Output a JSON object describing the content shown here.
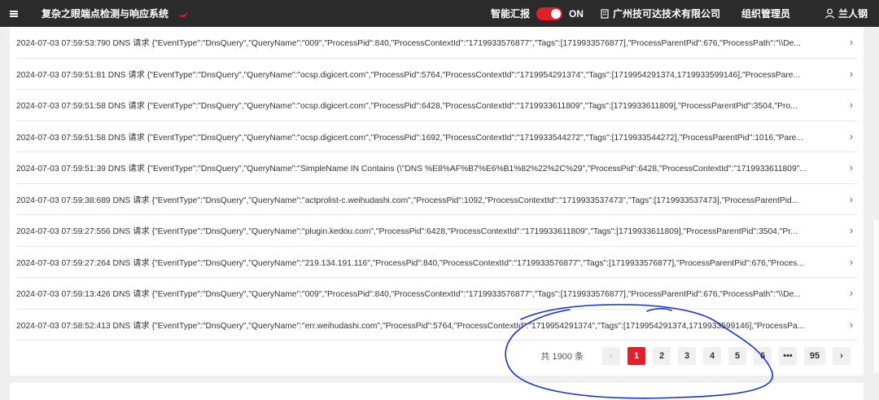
{
  "header": {
    "app_title": "复杂之眼端点检测与响应系统",
    "smart_report_label": "智能汇报",
    "toggle_state": "ON",
    "company": "广州技可达技术有限公司",
    "org_admin": "组织管理员",
    "user_name": "兰人钢"
  },
  "colors": {
    "brand": "#e0212b",
    "topbar": "#2b2b2b",
    "annotation": "#1a33c8"
  },
  "events": [
    {
      "text": "2024-07-03 07:59:53:790 DNS 请求 {\"EventType\":\"DnsQuery\",\"QueryName\":\"009\",\"ProcessPid\":840,\"ProcessContextId\":\"1719933576877\",\"Tags\":[1719933576877],\"ProcessParentPid\":676,\"ProcessPath\":\"\\\\De..."
    },
    {
      "text": "2024-07-03 07:59:51:81 DNS 请求 {\"EventType\":\"DnsQuery\",\"QueryName\":\"ocsp.digicert.com\",\"ProcessPid\":5764,\"ProcessContextId\":\"1719954291374\",\"Tags\":[1719954291374,1719933599146],\"ProcessPare..."
    },
    {
      "text": "2024-07-03 07:59:51:58 DNS 请求 {\"EventType\":\"DnsQuery\",\"QueryName\":\"ocsp.digicert.com\",\"ProcessPid\":6428,\"ProcessContextId\":\"1719933611809\",\"Tags\":[1719933611809],\"ProcessParentPid\":3504,\"Pro..."
    },
    {
      "text": "2024-07-03 07:59:51:58 DNS 请求 {\"EventType\":\"DnsQuery\",\"QueryName\":\"ocsp.digicert.com\",\"ProcessPid\":1692,\"ProcessContextId\":\"1719933544272\",\"Tags\":[1719933544272],\"ProcessParentPid\":1016,\"Pare..."
    },
    {
      "text": "2024-07-03 07:59:51:39 DNS 请求 {\"EventType\":\"DnsQuery\",\"QueryName\":\"SimpleName IN Contains (\\\"DNS %E8%AF%B7%E6%B1%82%22%2C%29\",\"ProcessPid\":6428,\"ProcessContextId\":\"1719933611809\"..."
    },
    {
      "text": "2024-07-03 07:59:38:689 DNS 请求 {\"EventType\":\"DnsQuery\",\"QueryName\":\"actprolist-c.weihudashi.com\",\"ProcessPid\":1092,\"ProcessContextId\":\"1719933537473\",\"Tags\":[1719933537473],\"ProcessParentPid..."
    },
    {
      "text": "2024-07-03 07:59:27:556 DNS 请求 {\"EventType\":\"DnsQuery\",\"QueryName\":\"plugin.kedou.com\",\"ProcessPid\":6428,\"ProcessContextId\":\"1719933611809\",\"Tags\":[1719933611809],\"ProcessParentPid\":3504,\"Pr..."
    },
    {
      "text": "2024-07-03 07:59:27:264 DNS 请求 {\"EventType\":\"DnsQuery\",\"QueryName\":\"219.134.191.116\",\"ProcessPid\":840,\"ProcessContextId\":\"1719933576877\",\"Tags\":[1719933576877],\"ProcessParentPid\":676,\"Proces..."
    },
    {
      "text": "2024-07-03 07:59:13:426 DNS 请求 {\"EventType\":\"DnsQuery\",\"QueryName\":\"009\",\"ProcessPid\":840,\"ProcessContextId\":\"1719933576877\",\"Tags\":[1719933576877],\"ProcessParentPid\":676,\"ProcessPath\":\"\\\\De..."
    },
    {
      "text": "2024-07-03 07:58:52:413 DNS 请求 {\"EventType\":\"DnsQuery\",\"QueryName\":\"err.weihudashi.com\",\"ProcessPid\":5764,\"ProcessContextId\":\"1719954291374\",\"Tags\":[1719954291374,1719933599146],\"ProcessPa..."
    }
  ],
  "pagination": {
    "total_label": "共 1900 条",
    "prev_icon": "chevron-left-icon",
    "next_icon": "chevron-right-icon",
    "pages": [
      "1",
      "2",
      "3",
      "4",
      "5",
      "6",
      "•••",
      "95"
    ],
    "current_page": "1"
  }
}
